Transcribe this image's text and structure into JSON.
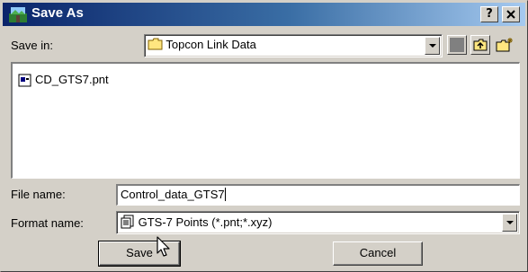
{
  "window": {
    "title": "Save As",
    "help_label": "?",
    "close_label": "X"
  },
  "save_in": {
    "label": "Save in:",
    "value": "Topcon Link Data"
  },
  "files": [
    {
      "name": "CD_GTS7.pnt"
    }
  ],
  "file_name": {
    "label": "File name:",
    "value": "Control_data_GTS7"
  },
  "format": {
    "label": "Format name:",
    "value": "GTS-7 Points (*.pnt;*.xyz)"
  },
  "buttons": {
    "save": "Save",
    "cancel": "Cancel"
  },
  "colors": {
    "titlebar_start": "#0a246a",
    "titlebar_end": "#a6caf0",
    "face": "#d4d0c8"
  }
}
